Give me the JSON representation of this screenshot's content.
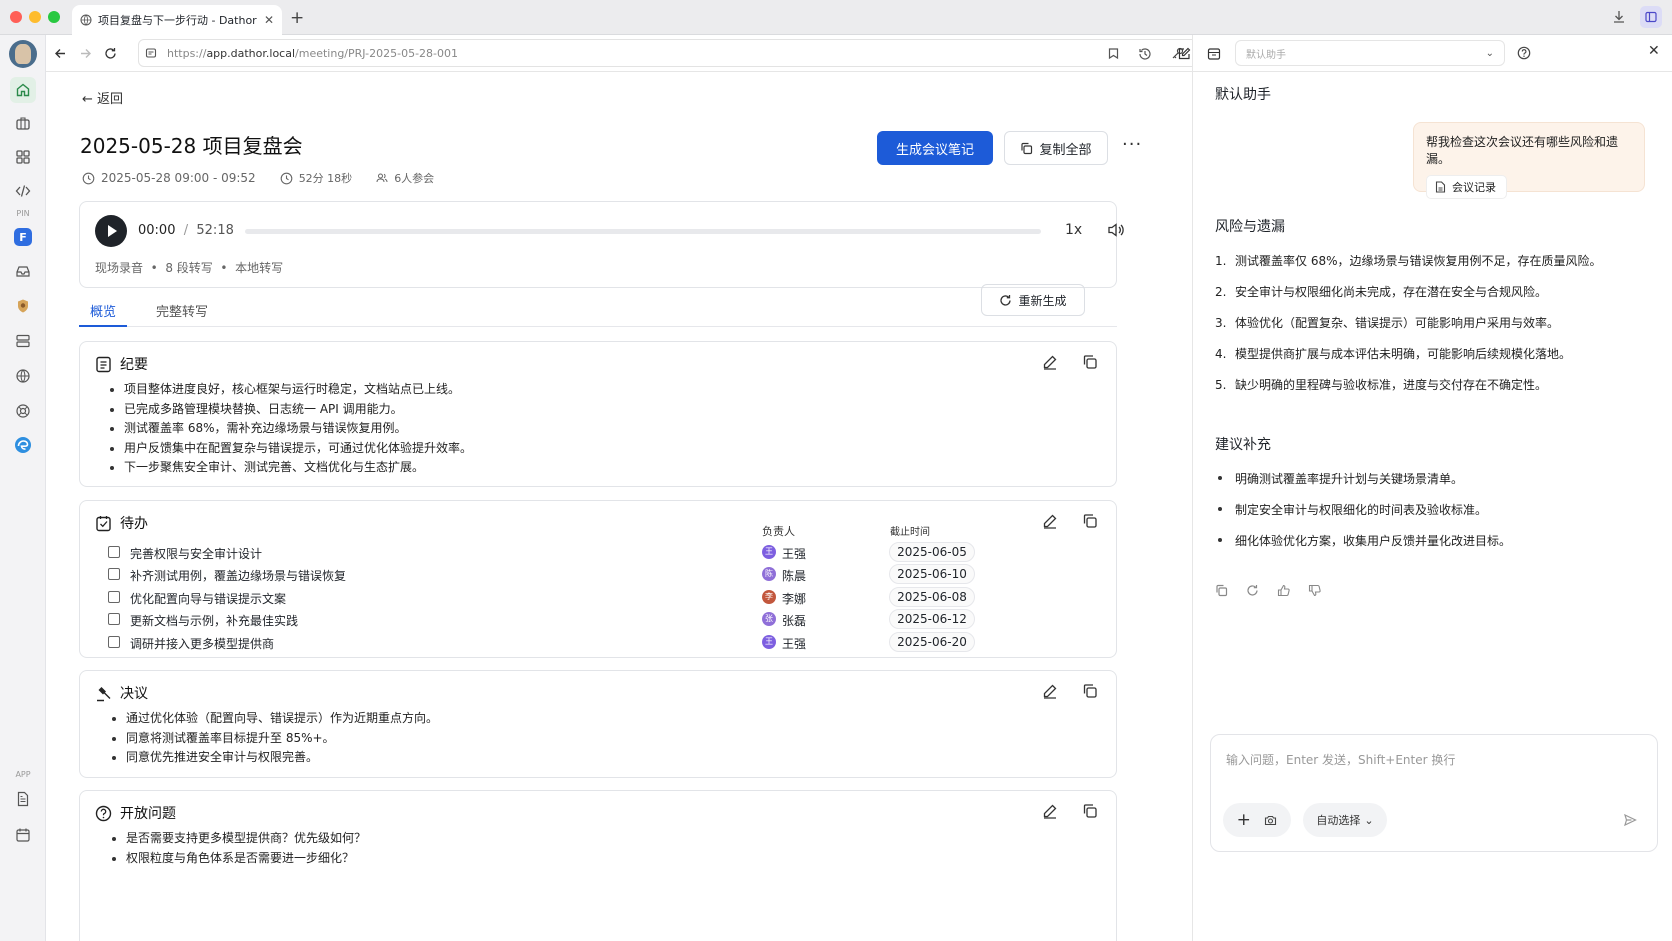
{
  "browser": {
    "tab_title": "项目复盘与下一步行动 - Dathor",
    "url_prefix": "https://",
    "url_host": "app.dathor.local",
    "url_path": "/meeting/PRJ-2025-05-28-001",
    "assistant_select": "默认助手"
  },
  "rail": {
    "pin_label": "PIN",
    "app_label": "APP"
  },
  "page": {
    "back_label": "返回",
    "title": "2025-05-28 项目复盘会",
    "time_range": "2025-05-28 09:00 - 09:52",
    "duration": "52分 18秒",
    "attendees": "6人参会",
    "generate_button": "生成会议笔记",
    "copy_all_button": "复制全部",
    "more_button": "···"
  },
  "player": {
    "current": "00:00",
    "sep": "/",
    "total": "52:18",
    "progress": 0,
    "speed": "1x",
    "info": "现场录音  •  8 段转写  •  本地转写"
  },
  "tabs": {
    "overview": "概览",
    "transcript": "完整转写",
    "regenerate": "重新生成"
  },
  "summary": {
    "title": "纪要",
    "items": [
      "项目整体进度良好，核心框架与运行时稳定，文档站点已上线。",
      "已完成多路管理模块替换、日志统一 API 调用能力。",
      "测试覆盖率 68%，需补充边缘场景与错误恢复用例。",
      "用户反馈集中在配置复杂与错误提示，可通过优化体验提升效率。",
      "下一步聚焦安全审计、测试完善、文档优化与生态扩展。"
    ]
  },
  "todos": {
    "title": "待办",
    "owner_header": "负责人",
    "due_header": "截止时间",
    "rows": [
      {
        "task": "完善权限与安全审计设计",
        "owner": "王强",
        "initial": "王",
        "color": "#7d5fe0",
        "due": "2025-06-05"
      },
      {
        "task": "补齐测试用例，覆盖边缘场景与错误恢复",
        "owner": "陈晨",
        "initial": "陈",
        "color": "#8f6fd8",
        "due": "2025-06-10"
      },
      {
        "task": "优化配置向导与错误提示文案",
        "owner": "李娜",
        "initial": "李",
        "color": "#c2573d",
        "due": "2025-06-08"
      },
      {
        "task": "更新文档与示例，补充最佳实践",
        "owner": "张磊",
        "initial": "张",
        "color": "#8f6fd8",
        "due": "2025-06-12"
      },
      {
        "task": "调研并接入更多模型提供商",
        "owner": "王强",
        "initial": "王",
        "color": "#7d5fe0",
        "due": "2025-06-20"
      }
    ]
  },
  "decisions": {
    "title": "决议",
    "items": [
      "通过优化体验（配置向导、错误提示）作为近期重点方向。",
      "同意将测试覆盖率目标提升至 85%+。",
      "同意优先推进安全审计与权限完善。"
    ]
  },
  "questions": {
    "title": "开放问题",
    "items": [
      "是否需要支持更多模型提供商？优先级如何？",
      "权限粒度与角色体系是否需要进一步细化？"
    ]
  },
  "assistant": {
    "title": "默认助手",
    "user_message": "帮我检查这次会议还有哪些风险和遗漏。",
    "attachment": "会议记录",
    "risks_title": "风险与遗漏",
    "risks": [
      "测试覆盖率仅 68%，边缘场景与错误恢复用例不足，存在质量风险。",
      "安全审计与权限细化尚未完成，存在潜在安全与合规风险。",
      "体验优化（配置复杂、错误提示）可能影响用户采用与效率。",
      "模型提供商扩展与成本评估未明确，可能影响后续规模化落地。",
      "缺少明确的里程碑与验收标准，进度与交付存在不确定性。"
    ],
    "suggest_title": "建议补充",
    "suggestions": [
      "明确测试覆盖率提升计划与关键场景清单。",
      "制定安全审计与权限细化的时间表及验收标准。",
      "细化体验优化方案，收集用户反馈并量化改进目标。"
    ],
    "input_placeholder": "输入问题，Enter 发送，Shift+Enter 换行",
    "mode_select": "自动选择"
  }
}
